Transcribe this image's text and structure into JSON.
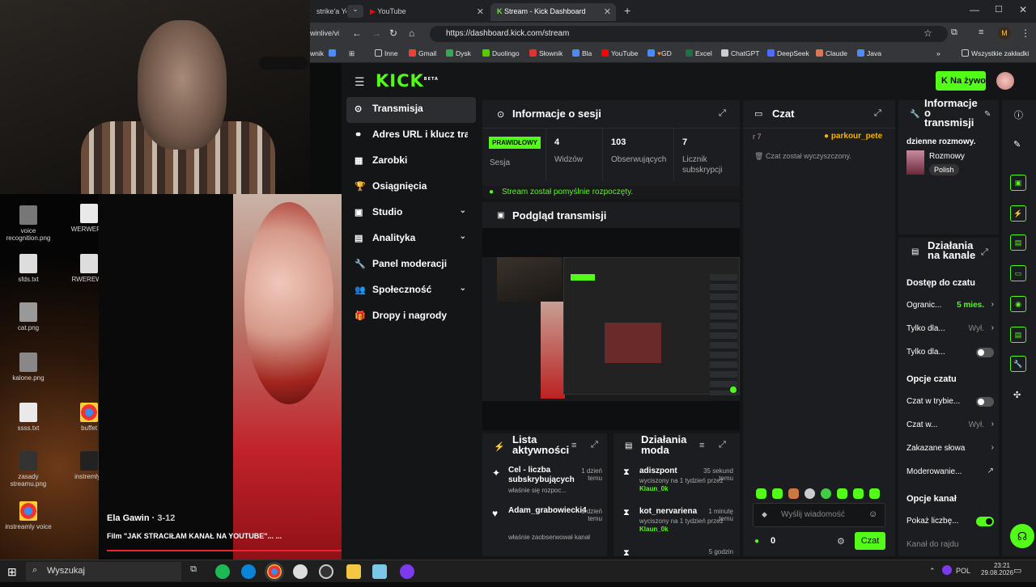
{
  "webcam": {
    "name": "webcam-feed"
  },
  "desktop_icons": [
    "voice recognition.png",
    "WERWERW",
    "sfds.txt",
    "RWEREWR",
    "cat.png",
    "kalone.png",
    "ssss.txt",
    "buffet",
    "zasady streamu.png",
    "instremly..",
    "instreamly voice"
  ],
  "video": {
    "channel": "Ela Gawin",
    "time": "3-12",
    "title": "Film \"JAK STRACIŁAM KANAŁ NA YOUTUBE\"... ..."
  },
  "browser": {
    "tabs": [
      {
        "label": "strike'a You"
      },
      {
        "label": "YouTube"
      },
      {
        "label": "Stream - Kick Dashboard"
      }
    ],
    "left_url_fragment": "winlive/vi",
    "url": "https://dashboard.kick.com/stream",
    "bookmarks": [
      "Inne",
      "Gmail",
      "Dysk",
      "Duolingo",
      "Słownik",
      "Bla",
      "YouTube",
      "GD",
      "Excel",
      "ChatGPT",
      "DeepSeek",
      "Claude",
      "Java"
    ],
    "bookmarks_left": "wnik",
    "bookmarks_all": "Wszystkie zakładki",
    "profile": "M"
  },
  "kick": {
    "logo": "KICK",
    "logo_badge": "BETA",
    "live_button": "Na żywo",
    "nav": [
      {
        "label": "Transmisja",
        "icon": "⊙",
        "active": true
      },
      {
        "label": "Adres URL i klucz transmisji",
        "icon": "⚭"
      },
      {
        "label": "Zarobki",
        "icon": "▦"
      },
      {
        "label": "Osiągnięcia",
        "icon": "🏆"
      },
      {
        "label": "Studio",
        "icon": "▣",
        "chevron": true
      },
      {
        "label": "Analityka",
        "icon": "▤",
        "chevron": true
      },
      {
        "label": "Panel moderacji",
        "icon": "🔧"
      },
      {
        "label": "Społeczność",
        "icon": "👥",
        "chevron": true
      },
      {
        "label": "Dropy i nagrody",
        "icon": "🎁"
      }
    ],
    "session": {
      "title": "Informacje o sesji",
      "badge": "PRAWIDŁOWY",
      "badge_label": "Sesja",
      "stats": [
        {
          "value": "4",
          "label": "Widzów"
        },
        {
          "value": "103",
          "label": "Obserwujących"
        },
        {
          "value": "7",
          "label": "Licznik subskrypcji"
        }
      ],
      "status": "Stream został pomyślnie rozpoczęty."
    },
    "preview": {
      "title": "Podgląd transmisji"
    },
    "activity": {
      "title": "Lista aktywności",
      "items": [
        {
          "name": "Cel - liczba subskrybujących",
          "time": "1 dzień temu",
          "sub": "właśnie się rozpoc..."
        },
        {
          "name": "Adam_grabowiecki4",
          "time": "1 dzień temu",
          "sub": "właśnie zaobserwował kanał"
        }
      ]
    },
    "mod": {
      "title": "Działania moda",
      "items": [
        {
          "name": "adiszpont",
          "time": "35 sekund temu",
          "detail": "wyciszony na 1 tydzień przez",
          "by": "Klaun_0k"
        },
        {
          "name": "kot_nervariena",
          "time": "1 minutę temu",
          "detail": "wyciszony na 1 tydzień przez",
          "by": "Klaun_0k"
        },
        {
          "name": "",
          "time": "5 godzin",
          "detail": "",
          "by": ""
        }
      ]
    },
    "chat": {
      "title": "Czat",
      "top_left": "r 7",
      "top_user": "parkour_pete",
      "cleared": "Czat został wyczyszczony.",
      "placeholder": "Wyślij wiadomość",
      "count": "0",
      "send": "Czat"
    },
    "info": {
      "title": "Informacje o transmisji",
      "line": "dzienne rozmowy.",
      "category": "Rozmowy",
      "language": "Polish"
    },
    "channel": {
      "title": "Działania na kanale",
      "sec1": "Dostęp do czatu",
      "rows1": [
        {
          "label": "Ogranic...",
          "value": "5 mies.",
          "kind": "chev"
        },
        {
          "label": "Tylko dla...",
          "value": "Wył.",
          "kind": "chev"
        },
        {
          "label": "Tylko dla...",
          "value": "",
          "kind": "toggle-off"
        }
      ],
      "sec2": "Opcje czatu",
      "rows2": [
        {
          "label": "Czat w trybie...",
          "value": "",
          "kind": "toggle-off"
        },
        {
          "label": "Czat w...",
          "value": "Wył.",
          "kind": "chev"
        },
        {
          "label": "Zakazane słowa",
          "value": "",
          "kind": "chev"
        },
        {
          "label": "Moderowanie...",
          "value": "",
          "kind": "ext"
        }
      ],
      "sec3": "Opcje kanał",
      "rows3": [
        {
          "label": "Pokaż liczbę...",
          "value": "",
          "kind": "toggle-on"
        },
        {
          "label": "Kanał do rajdu",
          "value": "",
          "kind": "none"
        }
      ]
    }
  },
  "taskbar": {
    "search": "Wyszukaj",
    "lang": "POL",
    "time": "23:21",
    "date": "29.08.2026"
  }
}
